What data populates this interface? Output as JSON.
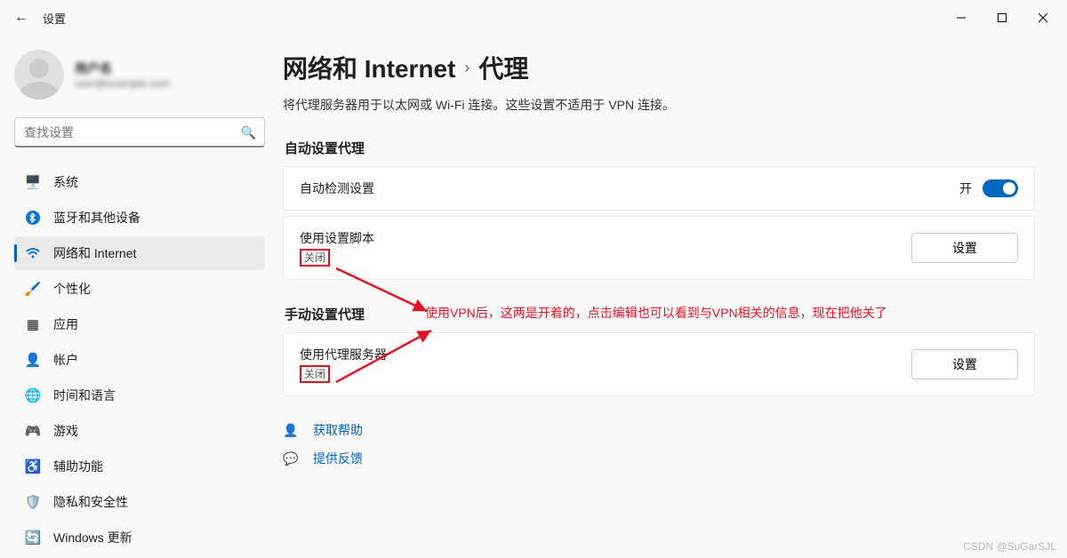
{
  "titlebar": {
    "title": "设置"
  },
  "profile": {
    "name": "用户名",
    "email": "user@example.com"
  },
  "search": {
    "placeholder": "查找设置"
  },
  "nav": {
    "items": [
      {
        "label": "系统",
        "icon": "🖥️"
      },
      {
        "label": "蓝牙和其他设备",
        "icon": "bt"
      },
      {
        "label": "网络和 Internet",
        "icon": "wifi",
        "selected": true
      },
      {
        "label": "个性化",
        "icon": "🖌️"
      },
      {
        "label": "应用",
        "icon": "▦"
      },
      {
        "label": "帐户",
        "icon": "👤"
      },
      {
        "label": "时间和语言",
        "icon": "🌐"
      },
      {
        "label": "游戏",
        "icon": "🎮"
      },
      {
        "label": "辅助功能",
        "icon": "♿"
      },
      {
        "label": "隐私和安全性",
        "icon": "🛡️"
      },
      {
        "label": "Windows 更新",
        "icon": "🔄"
      }
    ]
  },
  "breadcrumb": {
    "part1": "网络和 Internet",
    "sep": "›",
    "part2": "代理"
  },
  "desc": "将代理服务器用于以太网或 Wi-Fi 连接。这些设置不适用于 VPN 连接。",
  "sections": {
    "auto": {
      "title": "自动设置代理",
      "detect": {
        "label": "自动检测设置",
        "toggle_label": "开"
      },
      "script": {
        "label": "使用设置脚本",
        "status": "关闭",
        "button": "设置"
      }
    },
    "manual": {
      "title": "手动设置代理",
      "server": {
        "label": "使用代理服务器",
        "status": "关闭",
        "button": "设置"
      }
    }
  },
  "links": {
    "help": "获取帮助",
    "feedback": "提供反馈"
  },
  "annotation": "使用VPN后，这两是开着的，点击编辑也可以看到与VPN相关的信息，现在把他关了",
  "watermark": "CSDN @SuGarSJL"
}
